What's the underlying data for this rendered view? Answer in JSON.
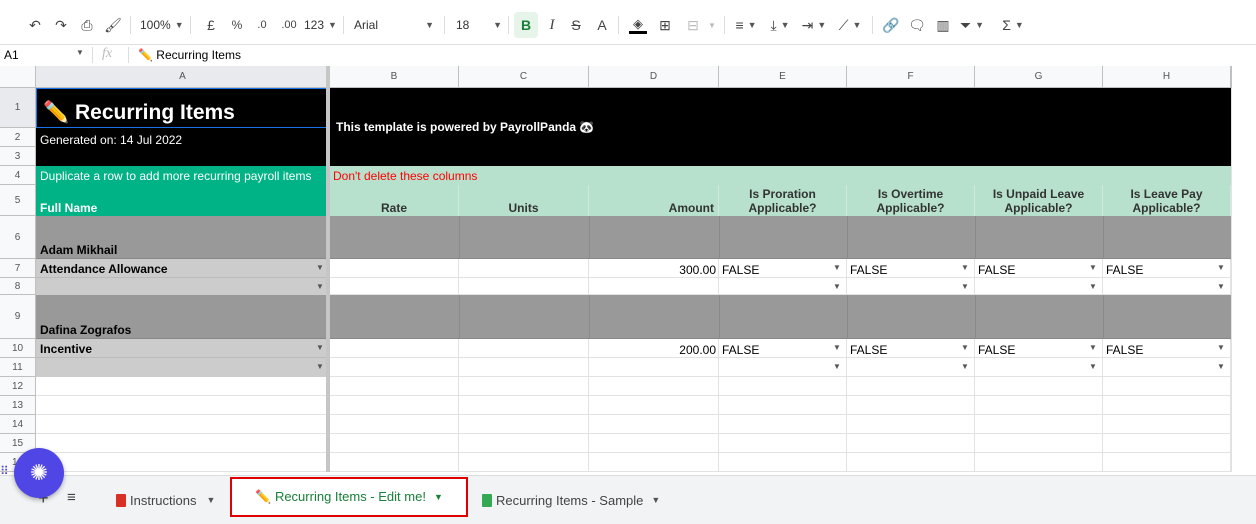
{
  "toolbar": {
    "zoom": "100%",
    "currency": "£",
    "percent": "%",
    "dec_decrease": ".0",
    "dec_increase": ".00",
    "more_formats": "123",
    "font": "Arial",
    "font_size": "18",
    "bold": "B",
    "italic": "I",
    "strike": "S",
    "text_color": "A",
    "sum": "Σ"
  },
  "formula_bar": {
    "cell_ref": "A1",
    "fx": "fx",
    "content": "✏️ Recurring Items"
  },
  "columns": [
    "A",
    "B",
    "C",
    "D",
    "E",
    "F",
    "G",
    "H"
  ],
  "rows": [
    "1",
    "2",
    "3",
    "4",
    "5",
    "6",
    "7",
    "8",
    "9",
    "10",
    "11",
    "12",
    "13",
    "14",
    "15",
    "16"
  ],
  "sheet": {
    "title": "✏️ Recurring Items",
    "generated": "Generated on: 14 Jul 2022",
    "powered_by": "This template is powered by PayrollPanda 🐼",
    "duplicate_note": "Duplicate a row to add more recurring payroll items",
    "dont_delete": "Don't delete these columns",
    "headers": {
      "full_name": "Full Name",
      "rate": "Rate",
      "units": "Units",
      "amount": "Amount",
      "proration_l1": "Is Proration",
      "proration_l2": "Applicable?",
      "overtime_l1": "Is Overtime",
      "overtime_l2": "Applicable?",
      "unpaid_l1": "Is Unpaid Leave",
      "unpaid_l2": "Applicable?",
      "leavepay_l1": "Is Leave Pay",
      "leavepay_l2": "Applicable?"
    },
    "employees": [
      {
        "name": "Adam Mikhail",
        "item": "Attendance Allowance",
        "amount": "300.00",
        "flags": [
          "FALSE",
          "FALSE",
          "FALSE",
          "FALSE"
        ]
      },
      {
        "name": "Dafina Zografos",
        "item": "Incentive",
        "amount": "200.00",
        "flags": [
          "FALSE",
          "FALSE",
          "FALSE",
          "FALSE"
        ]
      }
    ]
  },
  "tabs": [
    {
      "label": "Instructions",
      "color": "#d93025"
    },
    {
      "label": "✏️ Recurring Items - Edit me!",
      "color": "#188038"
    },
    {
      "label": "Recurring Items - Sample",
      "color": "#34a853"
    }
  ],
  "colors": {
    "black": "#000000",
    "green_header": "#00b386",
    "light_green": "#b7e1cd",
    "gray_band": "#999999",
    "light_gray": "#cccccc",
    "warning_red": "#ff0000",
    "active_tab_outline": "#e00000"
  }
}
